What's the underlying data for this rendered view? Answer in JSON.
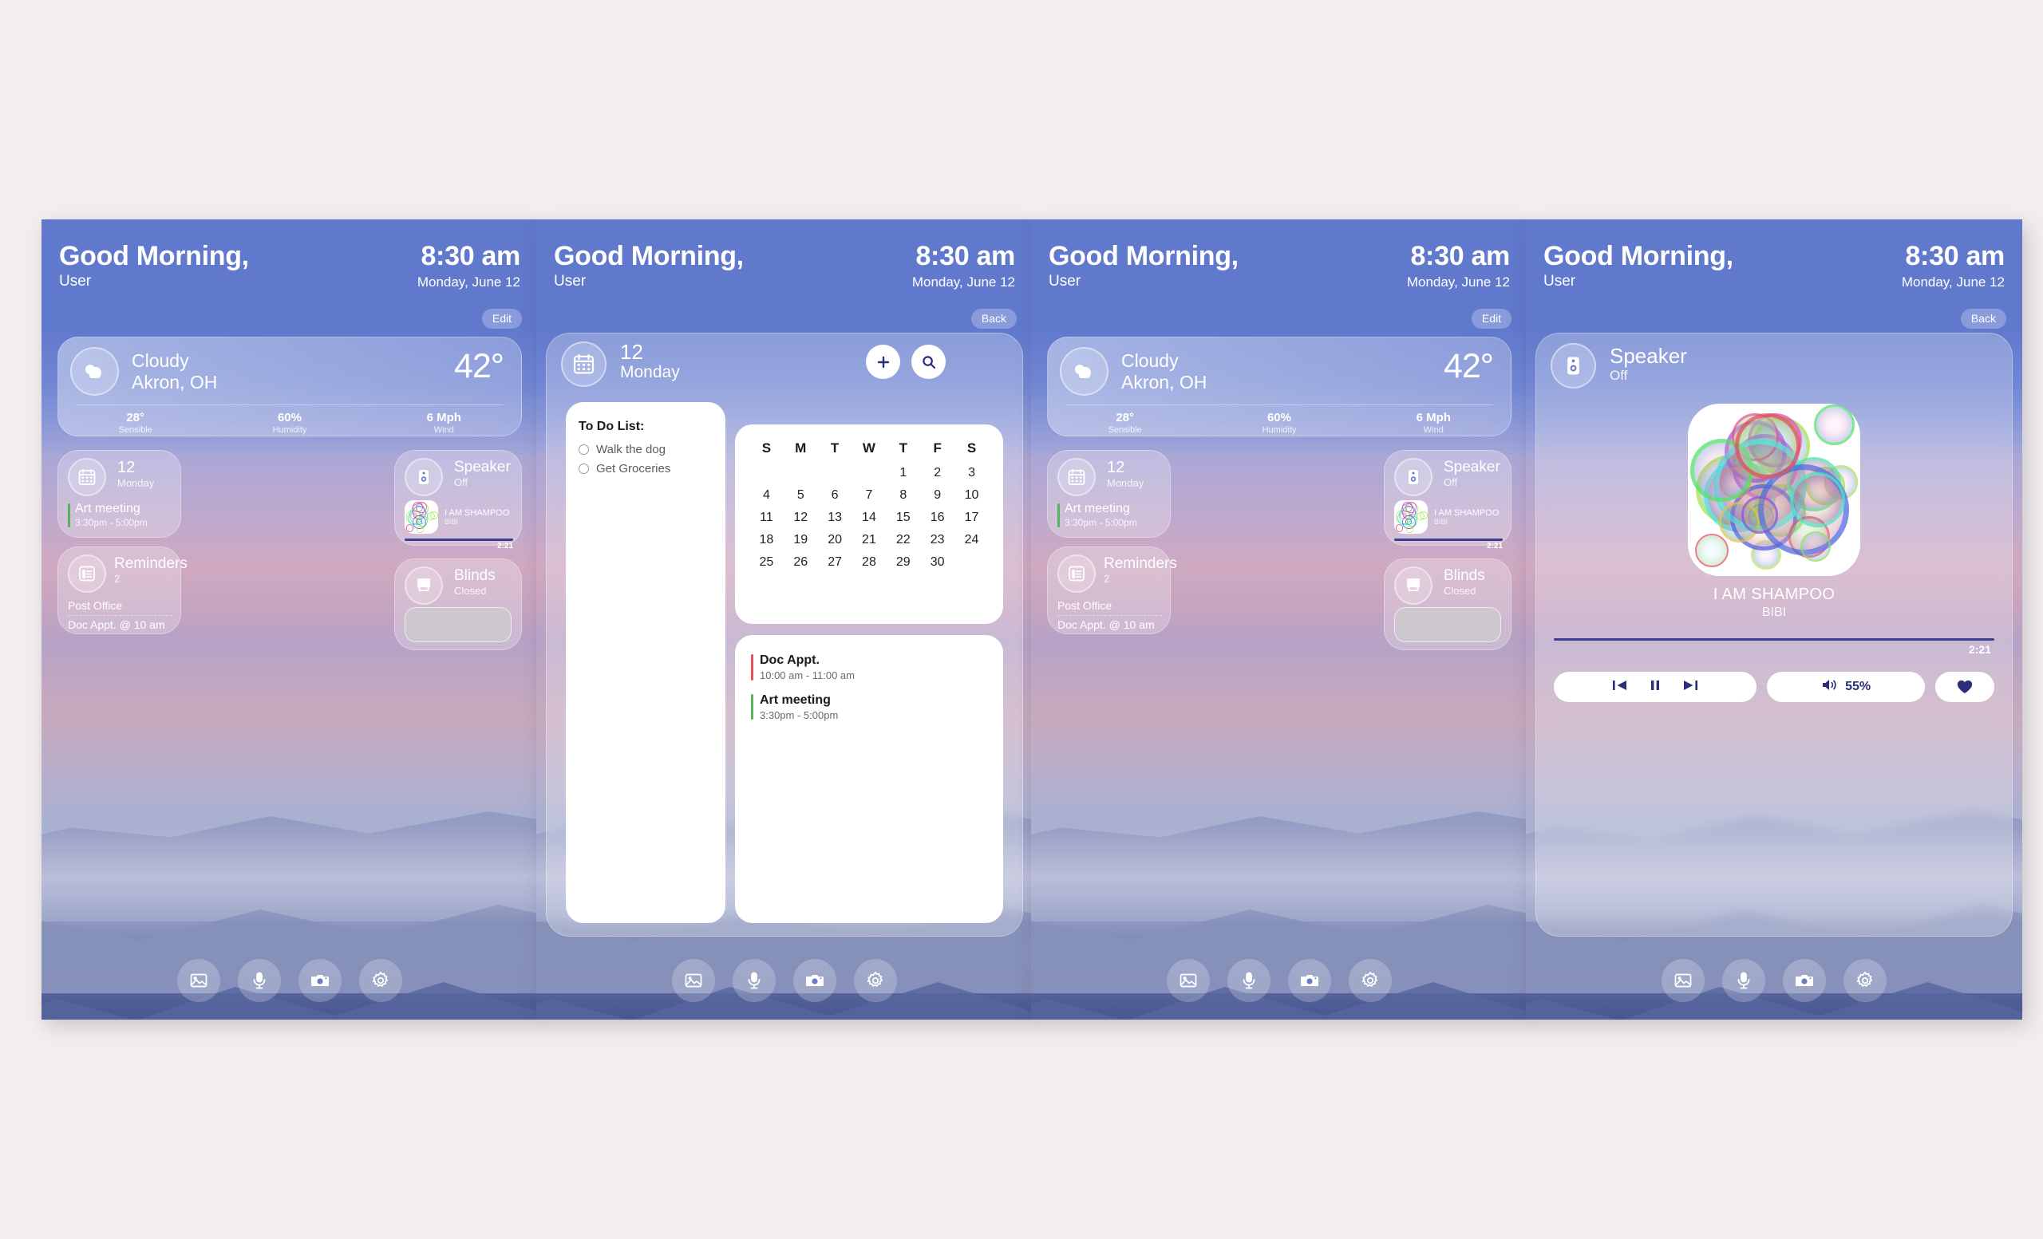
{
  "header": {
    "greeting": "Good Morning,",
    "user": "User",
    "time": "8:30 am",
    "date": "Monday, June 12"
  },
  "buttons": {
    "edit": "Edit",
    "back": "Back"
  },
  "weather": {
    "condition": "Cloudy",
    "location": "Akron, OH",
    "temperature": "42°",
    "stats": [
      {
        "value": "28°",
        "label": "Sensible"
      },
      {
        "value": "60%",
        "label": "Humidity"
      },
      {
        "value": "6 Mph",
        "label": "Wind"
      }
    ]
  },
  "calendar_widget": {
    "day_number": "12",
    "day_name": "Monday",
    "event_title": "Art meeting",
    "event_time": "3:30pm - 5:00pm"
  },
  "reminders_widget": {
    "title": "Reminders",
    "count": "2",
    "items": [
      "Post Office",
      "Doc Appt. @ 10 am"
    ]
  },
  "speaker_widget": {
    "title": "Speaker",
    "status": "Off",
    "track": "I AM SHAMPOO",
    "artist": "BIBI",
    "time": "2:21"
  },
  "blinds_widget": {
    "title": "Blinds",
    "status": "Closed"
  },
  "dock": [
    {
      "icon": "photos-icon"
    },
    {
      "icon": "microphone-icon"
    },
    {
      "icon": "camera-icon"
    },
    {
      "icon": "settings-gear-icon"
    }
  ],
  "calendar_screen": {
    "day_number": "12",
    "day_name": "Monday",
    "add_icon": "plus-icon",
    "search_icon": "search-icon",
    "todo": {
      "title": "To Do List:",
      "items": [
        "Walk the dog",
        "Get Groceries"
      ]
    },
    "weekdays": [
      "S",
      "M",
      "T",
      "W",
      "T",
      "F",
      "S"
    ],
    "weeks": [
      [
        "",
        "",
        "",
        "",
        "1",
        "2",
        "3"
      ],
      [
        "4",
        "5",
        "6",
        "7",
        "8",
        "9",
        "10"
      ],
      [
        "11",
        "12",
        "13",
        "14",
        "15",
        "16",
        "17"
      ],
      [
        "18",
        "19",
        "20",
        "21",
        "22",
        "23",
        "24"
      ],
      [
        "25",
        "26",
        "27",
        "28",
        "29",
        "30",
        ""
      ]
    ],
    "appointments": [
      {
        "title": "Doc Appt.",
        "time": "10:00 am - 11:00 am",
        "color": "#e8505b"
      },
      {
        "title": "Art meeting",
        "time": "3:30pm - 5:00pm",
        "color": "#56b45e"
      }
    ]
  },
  "speaker_screen": {
    "title": "Speaker",
    "status": "Off",
    "track": "I AM SHAMPOO",
    "artist": "BIBI",
    "time": "2:21",
    "volume": "55%",
    "controls": [
      "previous-track-icon",
      "pause-icon",
      "next-track-icon",
      "volume-icon",
      "favorite-heart-icon"
    ]
  },
  "colors": {
    "page_background": "#f2eef0",
    "sky": "#6179cd",
    "accent_dark_blue": "#2b2f7a",
    "event_green": "#56b45e",
    "event_red": "#e8505b"
  }
}
